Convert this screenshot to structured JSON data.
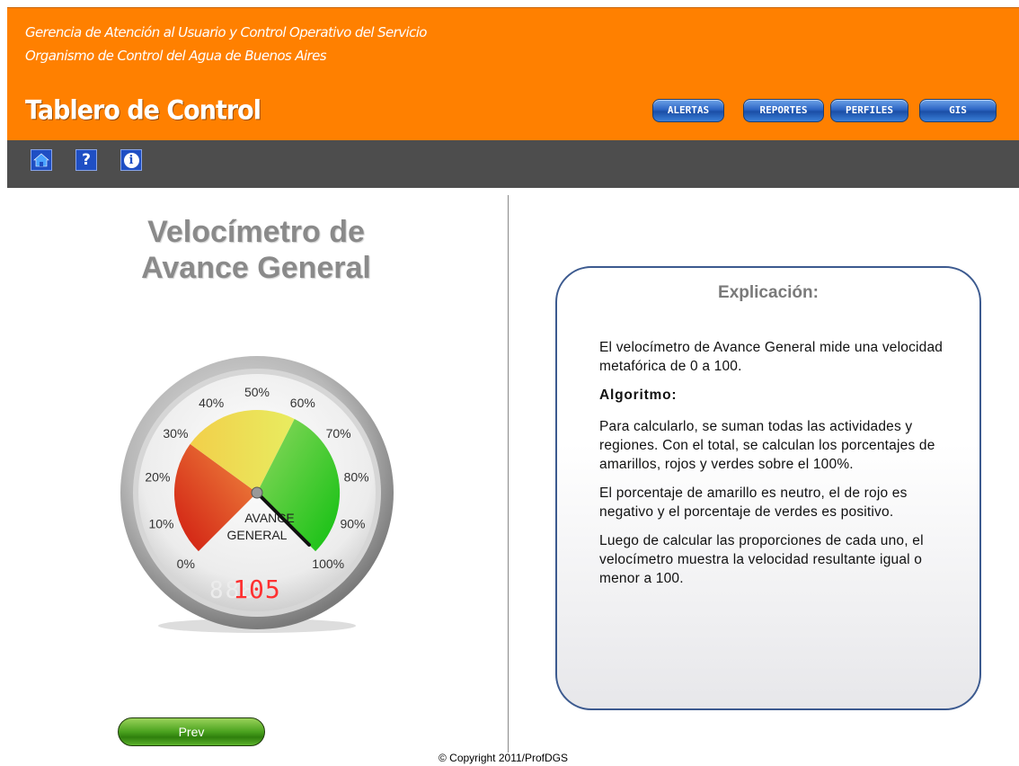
{
  "header": {
    "org_line1": "Gerencia de Atención al Usuario y Control Operativo del Servicio",
    "org_line2": "Organismo de Control del Agua de Buenos Aires",
    "app_title": "Tablero de Control",
    "nav": {
      "alertas": "ALERTAS",
      "reportes": "REPORTES",
      "perfiles": "PERFILES",
      "gis": "GIS"
    },
    "accent_color": "#ff8000"
  },
  "toolbar": {
    "icons": [
      "home-icon",
      "help-icon",
      "info-icon"
    ],
    "help_glyph": "?",
    "info_glyph": "i",
    "background_color": "#4d4d4d"
  },
  "gauge_panel": {
    "title_line1": "Velocímetro de",
    "title_line2": "Avance General",
    "gauge": {
      "tick_labels": [
        "0%",
        "10%",
        "20%",
        "30%",
        "40%",
        "50%",
        "60%",
        "70%",
        "80%",
        "90%",
        "100%"
      ],
      "center_label_line1": "AVANCE",
      "center_label_line2": "GENERAL",
      "digital_readout": "105",
      "needle_value_percent": 100,
      "zones": [
        {
          "name": "rojo",
          "from": 0,
          "to": 30,
          "color": "#e02a1a"
        },
        {
          "name": "amarillo",
          "from": 30,
          "to": 60,
          "color": "#f0e040"
        },
        {
          "name": "verde",
          "from": 60,
          "to": 100,
          "color": "#22cc10"
        }
      ]
    },
    "prev_label": "Prev"
  },
  "explanation": {
    "title": "Explicación:",
    "paragraph1": "El velocímetro de Avance General mide una velocidad metafórica de 0 a 100.",
    "algorithm_heading": "Algoritmo:",
    "paragraph2": "Para calcularlo, se suman todas las actividades y regiones. Con el total, se calculan los porcentajes de amarillos, rojos y verdes sobre el 100%.",
    "paragraph3": "El porcentaje de amarillo es neutro, el de rojo es negativo y el porcentaje de verdes es positivo.",
    "paragraph4": "Luego de calcular las proporciones de cada uno, el velocímetro muestra la velocidad resultante igual o menor a 100."
  },
  "footer": {
    "copyright": "© Copyright 2011/ProfDGS"
  }
}
